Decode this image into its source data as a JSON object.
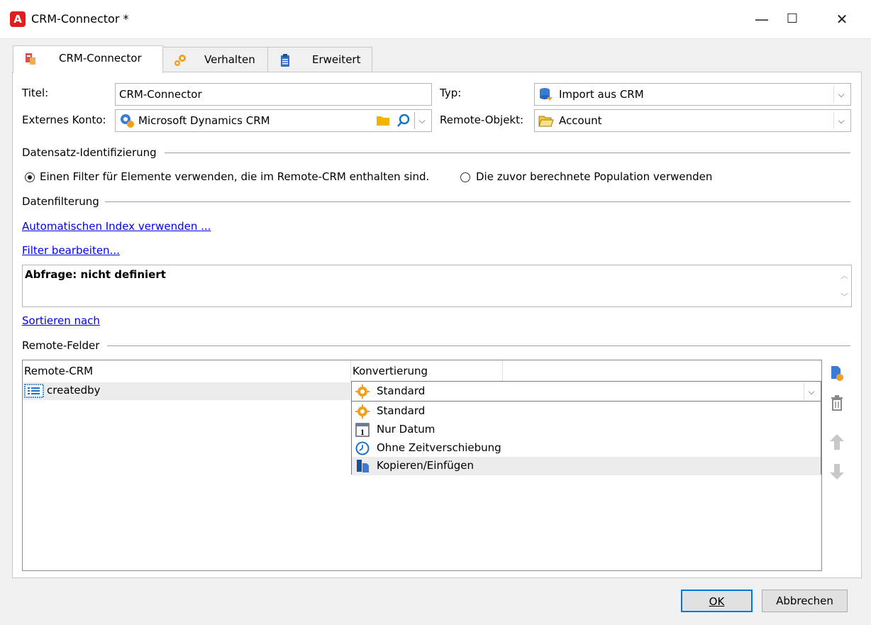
{
  "window": {
    "title": "CRM-Connector *",
    "minimize": "—",
    "maximize": "☐",
    "close": "✕",
    "logo_letter": "A"
  },
  "tabs": [
    {
      "label": "CRM-Connector",
      "active": true
    },
    {
      "label": "Verhalten",
      "active": false
    },
    {
      "label": "Erweitert",
      "active": false
    }
  ],
  "form": {
    "title_label": "Titel:",
    "title_value": "CRM-Connector",
    "type_label": "Typ:",
    "type_value": "Import aus CRM",
    "account_label": "Externes Konto:",
    "account_value": "Microsoft Dynamics CRM",
    "remote_object_label": "Remote-Objekt:",
    "remote_object_value": "Account"
  },
  "record_id": {
    "section": "Datensatz-Identifizierung",
    "option1": "Einen Filter für Elemente verwenden, die im Remote-CRM enthalten sind.",
    "option2": "Die zuvor berechnete Population verwenden",
    "selected": "option1"
  },
  "filtering": {
    "section": "Datenfilterung",
    "auto_index_link": "Automatischen Index verwenden ...",
    "edit_filter_link": "Filter bearbeiten...",
    "query_text": "Abfrage: nicht definiert",
    "sort_link": "Sortieren nach"
  },
  "remote_fields": {
    "section": "Remote-Felder",
    "columns": [
      "Remote-CRM",
      "Konvertierung"
    ],
    "rows": [
      {
        "name": "createdby",
        "conversion": "Standard"
      }
    ],
    "options": [
      "Standard",
      "Nur Datum",
      "Ohne Zeitverschiebung",
      "Kopieren/Einfügen"
    ],
    "highlighted_option": "Kopieren/Einfügen"
  },
  "buttons": {
    "ok": "OK",
    "cancel": "Abbrechen"
  },
  "colors": {
    "link": "#0000ee",
    "accent": "#0078d7",
    "row_highlight": "#ececec",
    "logo": "#e11d1d"
  }
}
